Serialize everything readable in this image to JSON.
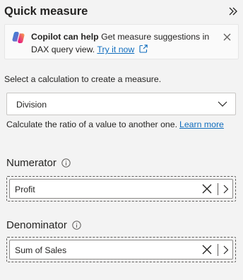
{
  "panel": {
    "title": "Quick measure",
    "collapse_icon": "double-chevron-right-icon"
  },
  "banner": {
    "heading": "Copilot can help",
    "text": "Get measure suggestions in DAX query view.",
    "link_label": "Try it now",
    "icons": [
      "copilot-icon",
      "external-link-icon",
      "close-icon"
    ]
  },
  "calculation": {
    "label": "Select a calculation to create a measure.",
    "selected": "Division",
    "description": "Calculate the ratio of a value to another one.",
    "learn_more": "Learn more"
  },
  "numerator": {
    "label": "Numerator",
    "value": "Profit"
  },
  "denominator": {
    "label": "Denominator",
    "value": "Sum of Sales"
  },
  "colors": {
    "background": "#f3f3f3",
    "link": "#0f6cbd",
    "text": "#252423",
    "field_background": "#ffffff"
  }
}
